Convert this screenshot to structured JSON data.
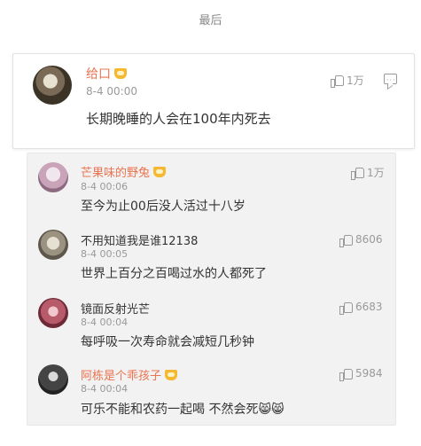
{
  "page_title": "最后",
  "main_comment": {
    "user": "给口",
    "time": "8-4 00:00",
    "text": "长期晚睡的人会在100年内死去",
    "likes": "1万"
  },
  "replies": [
    {
      "user": "芒果味的野兔",
      "time": "8-4 00:06",
      "text": "至今为止00后没人活过十八岁",
      "likes": "1万",
      "vip": true,
      "name_color": "#eb7350"
    },
    {
      "user": "不用知道我是谁12138",
      "time": "8-4 00:05",
      "text": "世界上百分之百喝过水的人都死了",
      "likes": "8606",
      "vip": false,
      "name_color": "#333333"
    },
    {
      "user": "镜面反射光芒",
      "time": "8-4 00:04",
      "text": "每呼吸一次寿命就会减短几秒钟",
      "likes": "6683",
      "vip": false,
      "name_color": "#333333"
    },
    {
      "user": "阿栋是个乖孩子",
      "time": "8-4 00:04",
      "text": "可乐不能和农药一起喝 不然会死",
      "likes": "5984",
      "vip": true,
      "name_color": "#eb7350",
      "trailing_emoji": "😸😸"
    }
  ],
  "colors": {
    "vip_name": "#eb7350",
    "muted": "#999999",
    "reply_bg": "#f2f2f2"
  },
  "icons": [
    "avatar",
    "vip-crown-icon",
    "thumb-up-icon",
    "comment-icon"
  ]
}
